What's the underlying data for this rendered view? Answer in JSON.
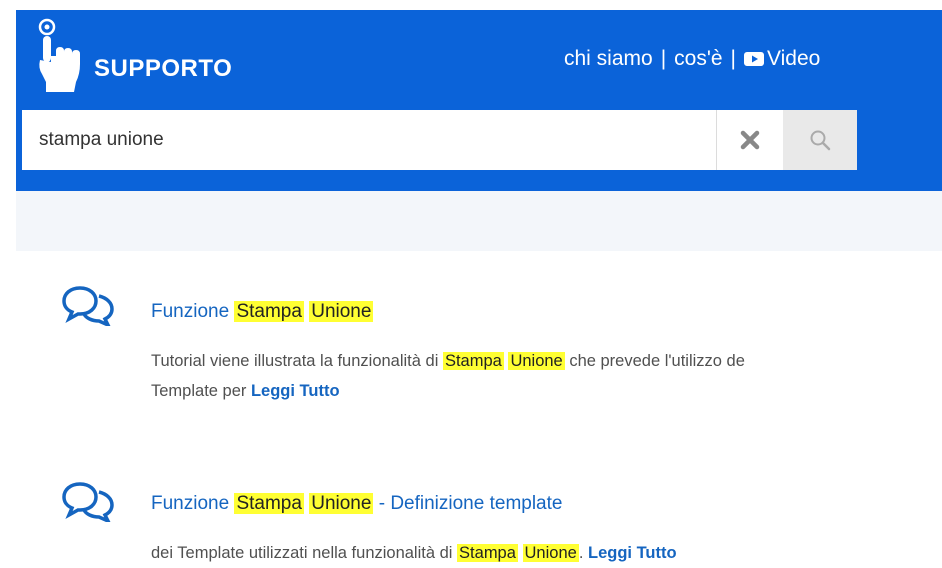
{
  "header": {
    "brand": "SUPPORTO",
    "nav": [
      {
        "label": "chi siamo"
      },
      {
        "label": "cos'è"
      },
      {
        "label": "Video",
        "icon": "video-play-icon"
      }
    ],
    "separator": "|",
    "colors": {
      "header_bg": "#0b63d9",
      "highlight": "#ffff33",
      "link": "#1565c0"
    }
  },
  "search": {
    "value": "stampa unione",
    "clear_icon": "close-icon",
    "search_icon": "search-icon"
  },
  "results": [
    {
      "icon": "chat-bubbles-icon",
      "title_prefix": "Funzione ",
      "title_hl1": "Stampa",
      "title_hl2": "Unione",
      "title_suffix": "",
      "desc_before": "Tutorial viene illustrata la funzionalità di ",
      "desc_hl1": "Stampa",
      "desc_hl2": "Unione",
      "desc_after": " che prevede l'utilizzo de",
      "desc_line2": "Template per ",
      "more": "Leggi Tutto"
    },
    {
      "icon": "chat-bubbles-icon",
      "title_prefix": "Funzione ",
      "title_hl1": "Stampa",
      "title_hl2": "Unione",
      "title_suffix": " - Definizione template",
      "desc_before": "dei Template utilizzati nella funzionalità di ",
      "desc_hl1": "Stampa",
      "desc_hl2": "Unione",
      "desc_after": ". ",
      "more": "Leggi Tutto"
    }
  ]
}
